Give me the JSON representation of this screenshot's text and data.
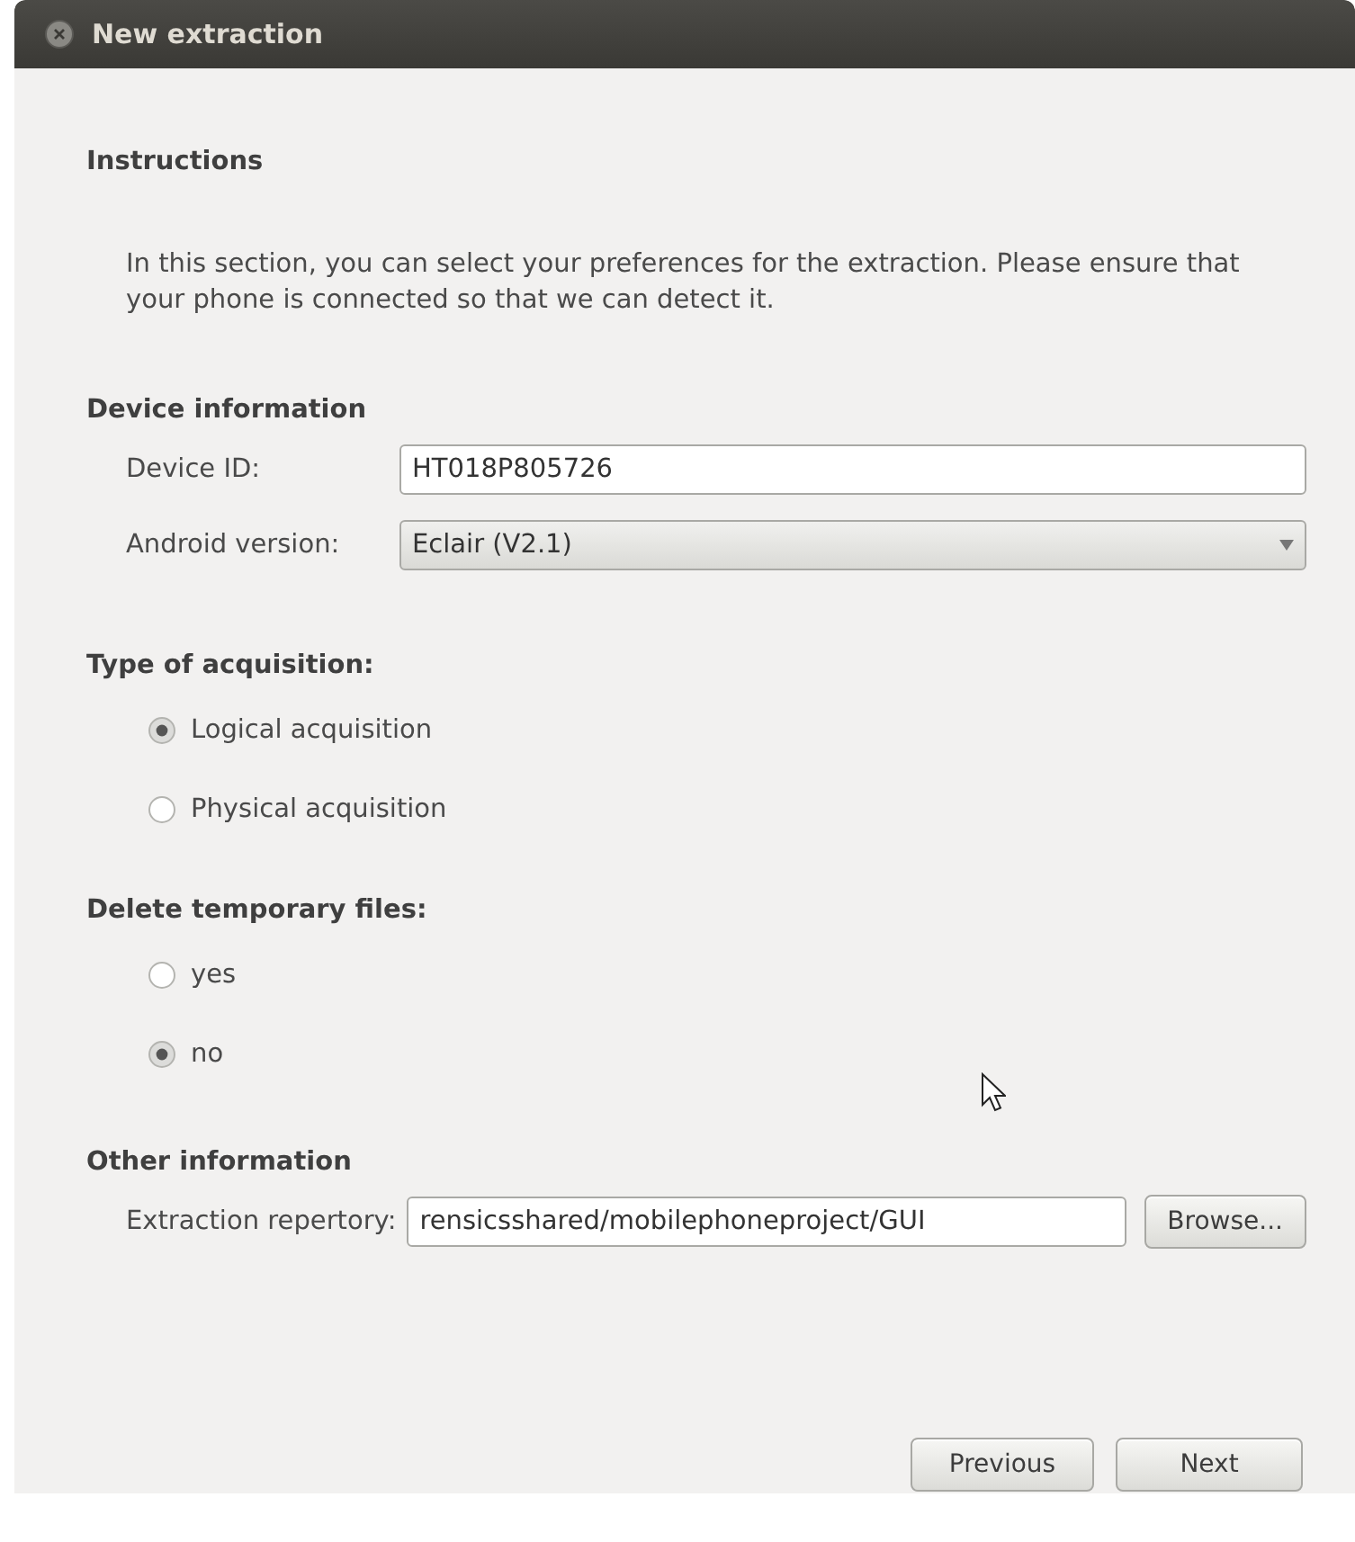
{
  "window": {
    "title": "New extraction"
  },
  "instructions": {
    "heading": "Instructions",
    "text": "In this section, you can select your preferences for the extraction. Please ensure that your phone is connected so that we can detect it."
  },
  "device_information": {
    "heading": "Device information",
    "fields": [
      {
        "kind": "text",
        "label": "Device ID:",
        "value": "HT018P805726"
      },
      {
        "kind": "dropdown",
        "label": "Android version:",
        "value": "Eclair (V2.1)"
      }
    ]
  },
  "acquisition": {
    "heading": "Type of acquisition:",
    "options": [
      {
        "label": "Logical acquisition",
        "selected": true
      },
      {
        "label": "Physical acquisition",
        "selected": false
      }
    ]
  },
  "delete_temporary_files": {
    "heading": "Delete temporary files:",
    "options": [
      {
        "label": "yes",
        "selected": false
      },
      {
        "label": "no",
        "selected": true
      }
    ]
  },
  "other_information": {
    "heading": "Other information",
    "field": {
      "label": "Extraction repertory:",
      "value": "rensicsshared/mobilephoneproject/GUI"
    },
    "browse_button": "Browse..."
  },
  "buttons": [
    "Previous",
    "Next"
  ]
}
